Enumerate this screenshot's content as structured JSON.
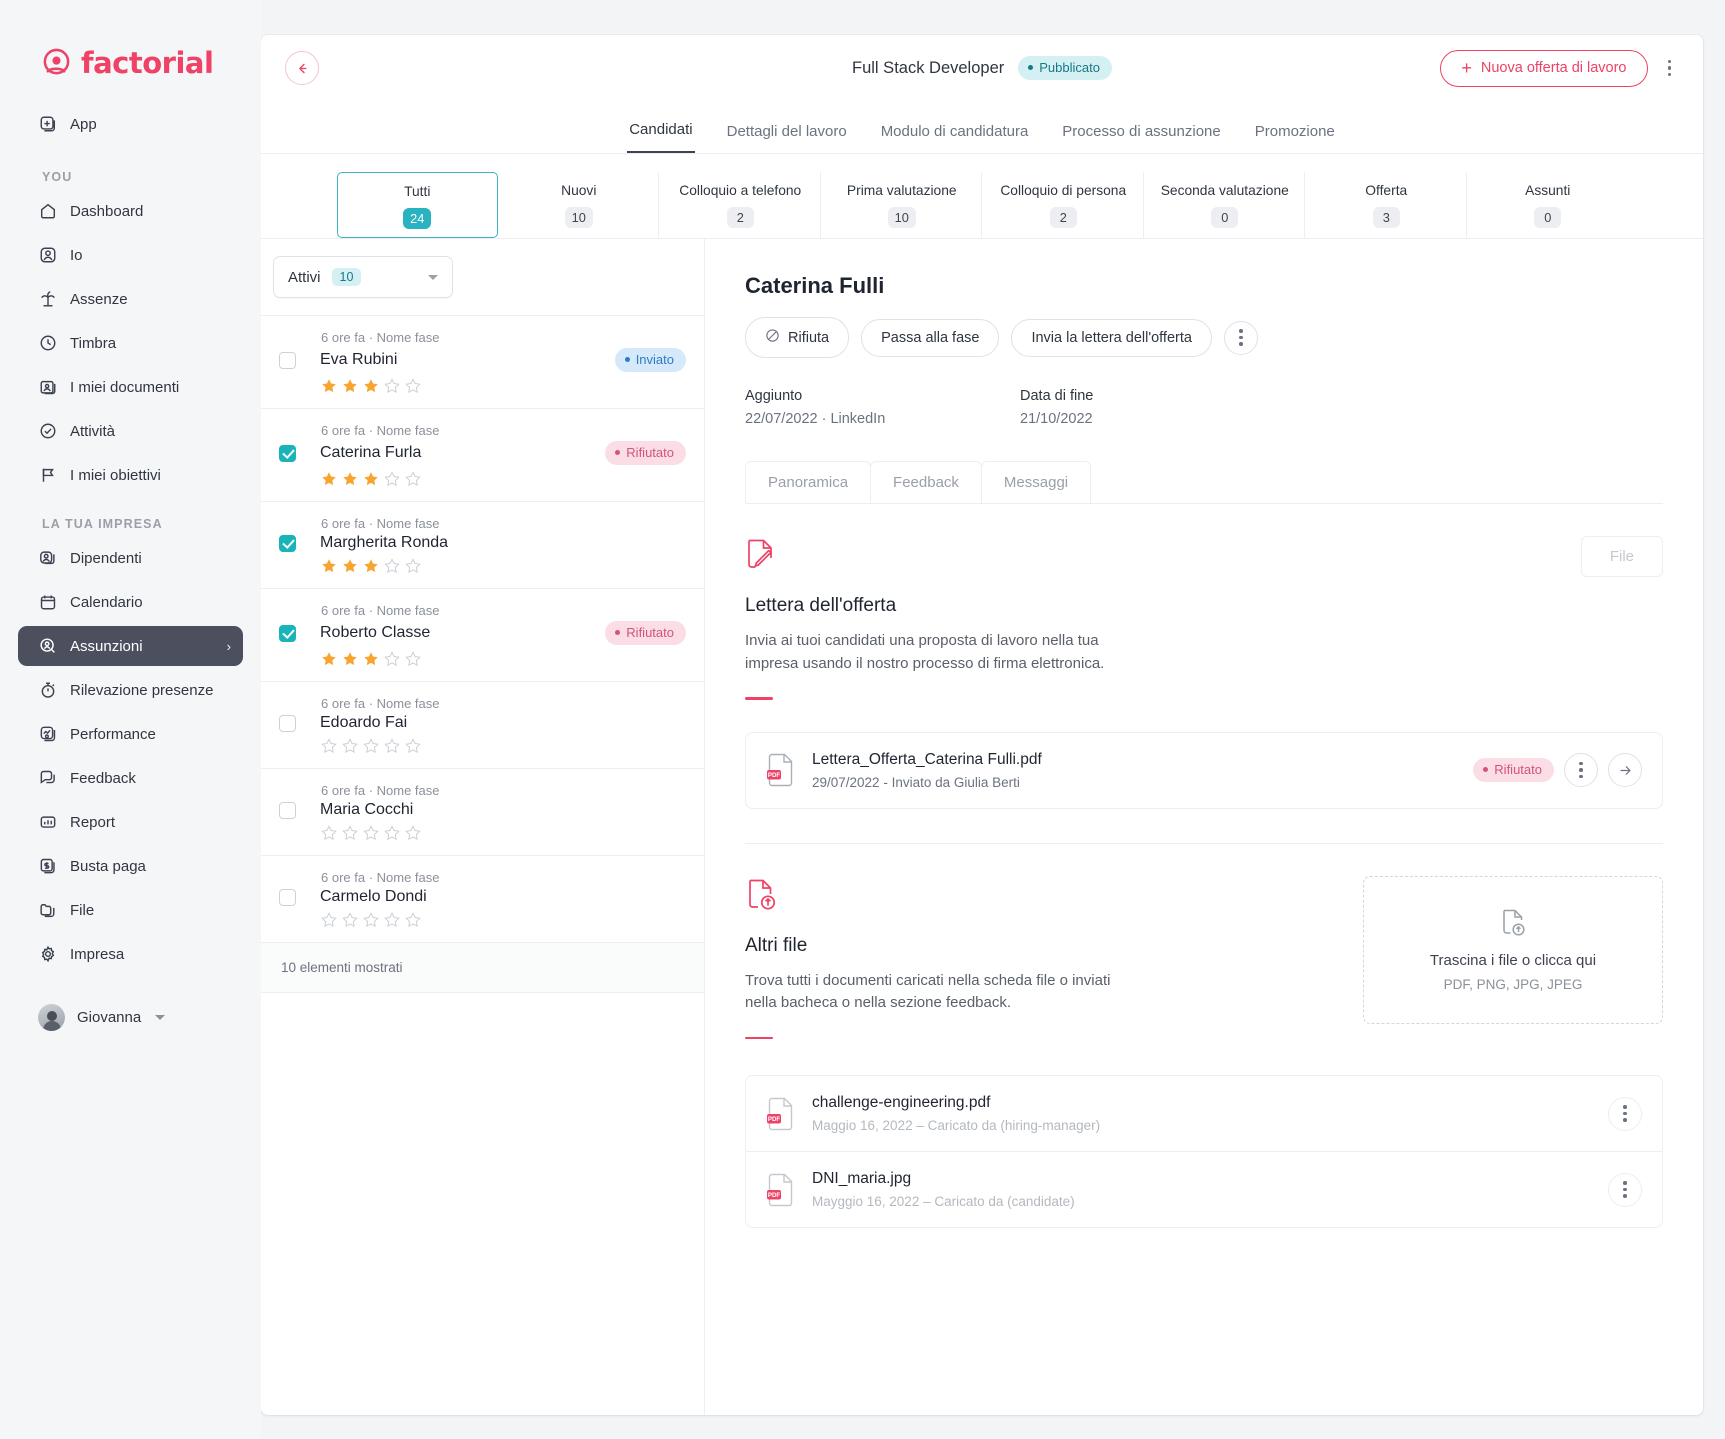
{
  "brand": {
    "name": "factorial",
    "accent": "#ee4266",
    "teal": "#29b2bf"
  },
  "sidebar": {
    "app_label": "App",
    "section_you": "YOU",
    "section_company": "LA TUA IMPRESA",
    "you_items": [
      {
        "label": "Dashboard",
        "icon": "home-icon"
      },
      {
        "label": "Io",
        "icon": "person-icon"
      },
      {
        "label": "Assenze",
        "icon": "palm-tree-icon"
      },
      {
        "label": "Timbra",
        "icon": "clock-icon"
      },
      {
        "label": "I miei documenti",
        "icon": "documents-icon"
      },
      {
        "label": "Attività",
        "icon": "check-circle-icon"
      },
      {
        "label": "I miei obiettivi",
        "icon": "flag-icon"
      }
    ],
    "company_items": [
      {
        "label": "Dipendenti",
        "icon": "people-icon"
      },
      {
        "label": "Calendario",
        "icon": "calendar-icon"
      },
      {
        "label": "Assunzioni",
        "icon": "search-person-icon",
        "active": true
      },
      {
        "label": "Rilevazione presenze",
        "icon": "stopwatch-icon"
      },
      {
        "label": "Performance",
        "icon": "performance-icon"
      },
      {
        "label": "Feedback",
        "icon": "chat-icon"
      },
      {
        "label": "Report",
        "icon": "bar-chart-icon"
      },
      {
        "label": "Busta paga",
        "icon": "payslip-icon"
      },
      {
        "label": "File",
        "icon": "folder-icon"
      },
      {
        "label": "Impresa",
        "icon": "gear-icon"
      }
    ],
    "user": {
      "name": "Giovanna"
    }
  },
  "header": {
    "job_title": "Full Stack Developer",
    "status_badge": "Pubblicato",
    "new_job_button": "Nuova offerta di lavoro"
  },
  "tabs": [
    {
      "label": "Candidati",
      "active": true
    },
    {
      "label": "Dettagli del lavoro",
      "active": false
    },
    {
      "label": "Modulo di candidatura",
      "active": false
    },
    {
      "label": "Processo di assunzione",
      "active": false
    },
    {
      "label": "Promozione",
      "active": false
    }
  ],
  "stages": [
    {
      "label": "Tutti",
      "count": "24",
      "selected": true
    },
    {
      "label": "Nuovi",
      "count": "10",
      "selected": false
    },
    {
      "label": "Colloquio a telefono",
      "count": "2",
      "selected": false
    },
    {
      "label": "Prima valutazione",
      "count": "10",
      "selected": false
    },
    {
      "label": "Colloquio di persona",
      "count": "2",
      "selected": false
    },
    {
      "label": "Seconda valutazione",
      "count": "0",
      "selected": false
    },
    {
      "label": "Offerta",
      "count": "3",
      "selected": false
    },
    {
      "label": "Assunti",
      "count": "0",
      "selected": false
    }
  ],
  "candidate_list": {
    "filter": {
      "label": "Attivi",
      "count": "10"
    },
    "footer": "10 elementi mostrati",
    "rows": [
      {
        "meta": "6 ore fa · Nome fase",
        "name": "Eva Rubini",
        "checked": false,
        "stars": 3,
        "status": "Inviato",
        "status_kind": "inviato"
      },
      {
        "meta": "6 ore fa · Nome fase",
        "name": "Caterina Furla",
        "checked": true,
        "stars": 3,
        "status": "Rifiutato",
        "status_kind": "rifiutato"
      },
      {
        "meta": "6 ore fa · Nome fase",
        "name": "Margherita Ronda",
        "checked": true,
        "stars": 3,
        "status": "",
        "status_kind": ""
      },
      {
        "meta": "6 ore fa · Nome fase",
        "name": "Roberto Classe",
        "checked": true,
        "stars": 3,
        "status": "Rifiutato",
        "status_kind": "rifiutato"
      },
      {
        "meta": "6 ore fa · Nome fase",
        "name": "Edoardo Fai",
        "checked": false,
        "stars": 0,
        "status": "",
        "status_kind": ""
      },
      {
        "meta": "6 ore fa · Nome fase",
        "name": "Maria Cocchi",
        "checked": false,
        "stars": 0,
        "status": "",
        "status_kind": ""
      },
      {
        "meta": "6 ore fa · Nome fase",
        "name": "Carmelo Dondi",
        "checked": false,
        "stars": 0,
        "status": "",
        "status_kind": ""
      }
    ]
  },
  "detail": {
    "name": "Caterina Fulli",
    "actions": {
      "reject": "Rifiuta",
      "next_stage": "Passa alla fase",
      "send_offer": "Invia la lettera dell'offerta"
    },
    "meta": {
      "added_label": "Aggiunto",
      "added_value": "22/07/2022 · LinkedIn",
      "end_label": "Data di fine",
      "end_value": "21/10/2022"
    },
    "sub_tabs": [
      {
        "label": "Panoramica"
      },
      {
        "label": "Feedback"
      },
      {
        "label": "Messaggi"
      }
    ],
    "offer_section": {
      "file_button": "File",
      "title": "Lettera dell'offerta",
      "description": "Invia ai tuoi candidati una proposta di lavoro nella tua impresa usando il nostro processo di firma elettronica.",
      "file": {
        "name": "Lettera_Offerta_Caterina Fulli.pdf",
        "sub": "29/07/2022 - Inviato da Giulia Berti",
        "status": "Rifiutato"
      }
    },
    "other_files_section": {
      "title": "Altri file",
      "description": "Trova tutti i documenti caricati nella scheda file o inviati nella bacheca o nella sezione feedback.",
      "dropzone": {
        "main": "Trascina i file o clicca qui",
        "sub": "PDF, PNG, JPG, JPEG"
      },
      "files": [
        {
          "name": "challenge-engineering.pdf",
          "sub": "Maggio 16, 2022 – Caricato da (hiring-manager)"
        },
        {
          "name": "DNI_maria.jpg",
          "sub": "Mayggio 16, 2022 – Caricato da (candidate)"
        }
      ]
    }
  }
}
